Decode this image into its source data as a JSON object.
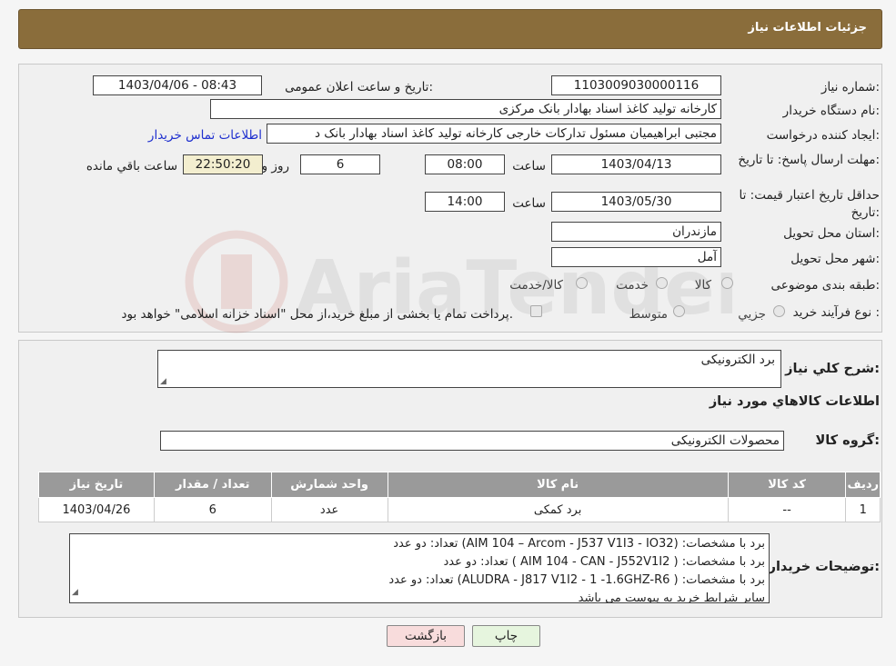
{
  "header": {
    "title": "جزئیات اطلاعات نیاز"
  },
  "fields": {
    "need_number_label": "شماره نیاز:",
    "need_number": "1103009030000116",
    "announce_label": "تاریخ و ساعت اعلان عمومی:",
    "announce_value": "1403/04/06 - 08:43",
    "buyer_org_label": "نام دستگاه خریدار:",
    "buyer_org": "کارخانه تولید کاغذ اسناد بهادار بانک مرکزی",
    "creator_label": "ایجاد کننده درخواست:",
    "creator": "مجتبی ابراهیمیان مسئول تدارکات خارجی کارخانه تولید کاغذ اسناد بهادار بانک د",
    "contact_link": "اطلاعات تماس خریدار",
    "deadline_label": "مهلت ارسال پاسخ: تا تاریخ:",
    "deadline_date": "1403/04/13",
    "time_label": "ساعت",
    "deadline_time": "08:00",
    "days_value": "6",
    "days_label": "روز و",
    "remaining_time": "22:50:20",
    "remaining_label": "ساعت باقي مانده",
    "validity_label": "حداقل تاریخ اعتبار قیمت: تا تاریخ:",
    "validity_date": "1403/05/30",
    "validity_time": "14:00",
    "province_label": "استان محل تحویل:",
    "province": "مازندران",
    "city_label": "شهر محل تحویل:",
    "city": "آمل",
    "category_label": "طبقه بندی موضوعی:",
    "category_options": [
      "کالا",
      "خدمت",
      "کالا/خدمت"
    ],
    "process_label": "نوع فرآیند خرید :",
    "process_options": [
      "جزيي",
      "متوسط"
    ],
    "process_note": "پرداخت تمام یا بخشی از مبلغ خرید،از محل \"اسناد خزانه اسلامی\" خواهد بود."
  },
  "summary": {
    "description_label": "شرح کلي نياز:",
    "description": "برد الکترونیکی",
    "goods_info_title": "اطلاعات کالاهاي مورد نياز",
    "group_label": "گروه کالا:",
    "group_value": "محصولات الکترونیکی"
  },
  "table": {
    "headers": [
      "رديف",
      "کد کالا",
      "نام کالا",
      "واحد شمارش",
      "تعداد / مقدار",
      "تاريخ نياز"
    ],
    "rows": [
      [
        "1",
        "--",
        "برد کمکی",
        "عدد",
        "6",
        "1403/04/26"
      ]
    ]
  },
  "notes": {
    "label": "توضيحات خريدار:",
    "lines": [
      "برد با مشخصات: (AIM 104 – Arcom - J537 V1I3 - IO32)  تعداد: دو عدد",
      "برد با مشخصات: ( AIM 104 - CAN -  J552V1I2 )  تعداد: دو عدد",
      "برد با مشخصات: (  ALUDRA - J817 V1I2 - 1 -1.6GHZ-R6)  تعداد: دو عدد",
      "سایر شرایط خرید به پیوست می باشد"
    ]
  },
  "buttons": {
    "print": "چاپ",
    "back": "بازگشت"
  },
  "watermark": {
    "text": "AriaTender.neT"
  },
  "colors": {
    "header_bg": "#8a6d3b",
    "table_header": "#9a9a9a",
    "link": "#1e2fcf",
    "back_btn": "#f8dcdc",
    "print_btn": "#e6f5de"
  }
}
